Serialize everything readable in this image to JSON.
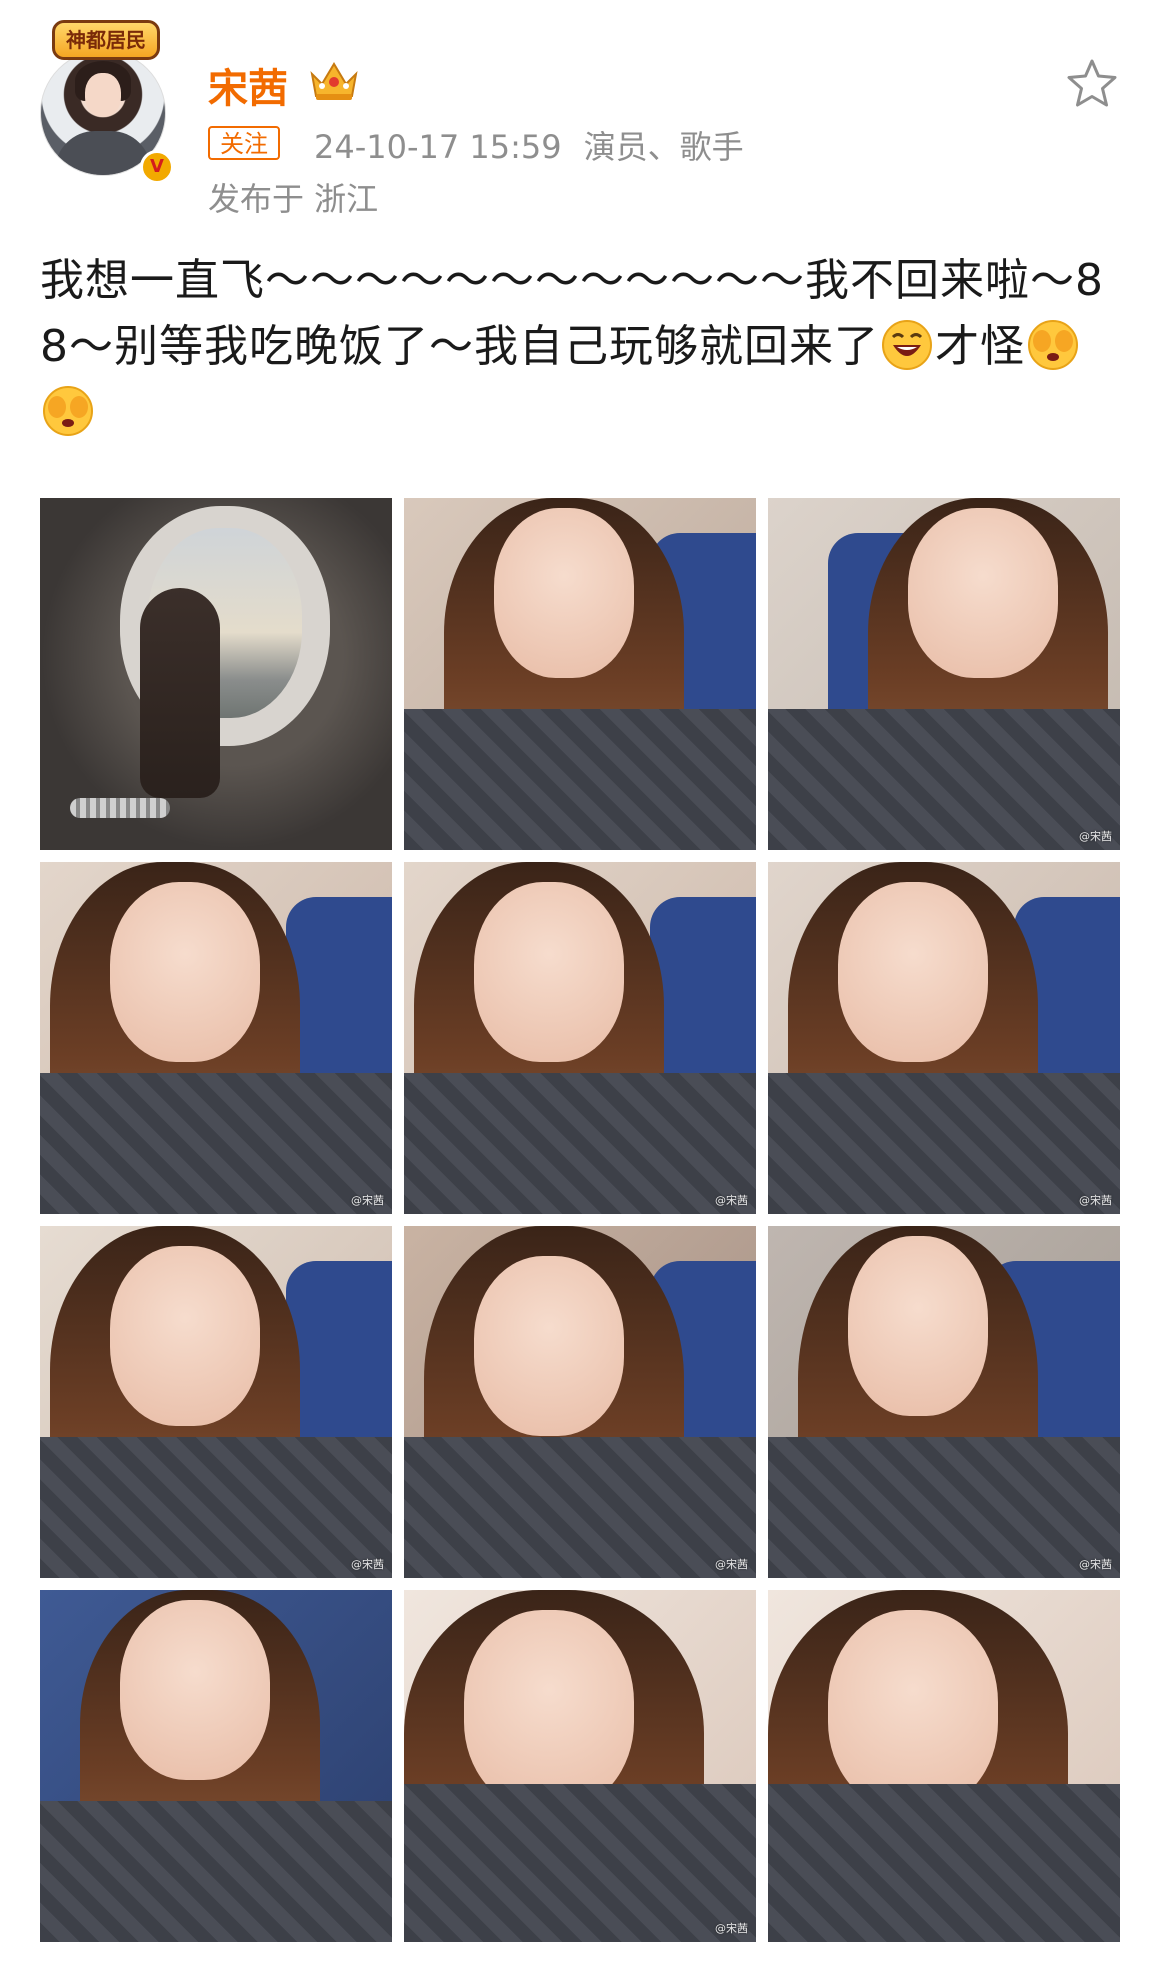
{
  "header": {
    "avatar_badge_text": "神都居民",
    "username": "宋茜",
    "follow_label": "关注",
    "timestamp": "24-10-17 15:59",
    "tags": "演员、歌手",
    "location": "发布于 浙江",
    "verified_badge": "V"
  },
  "post": {
    "text_1": "我想一直飞～～～～～～～～～～～～我不回来啦～88～别等我吃晚饭了～我自己玩够就回来了",
    "text_2": "才怪"
  },
  "photos": {
    "watermark": "@宋茜",
    "count": 12
  },
  "colors": {
    "accent": "#f26b00",
    "meta_gray": "#8e8e8e"
  },
  "icons": [
    "crown-icon",
    "star-icon",
    "verified-icon",
    "laugh-emoji",
    "shy-emoji"
  ]
}
